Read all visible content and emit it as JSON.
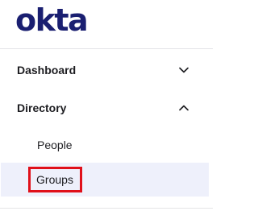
{
  "brand": {
    "logo_text": "okta",
    "logo_color": "#1a1f71"
  },
  "nav": {
    "sections": [
      {
        "label": "Dashboard",
        "expanded": false,
        "chevron": "chevron-down-icon"
      },
      {
        "label": "Directory",
        "expanded": true,
        "chevron": "chevron-up-icon",
        "items": [
          {
            "label": "People",
            "selected": false
          },
          {
            "label": "Groups",
            "selected": true,
            "highlighted": true
          }
        ]
      }
    ]
  },
  "colors": {
    "selected_background": "#eef0fb",
    "highlight_border": "#e0101a",
    "text": "#1d1d21"
  }
}
